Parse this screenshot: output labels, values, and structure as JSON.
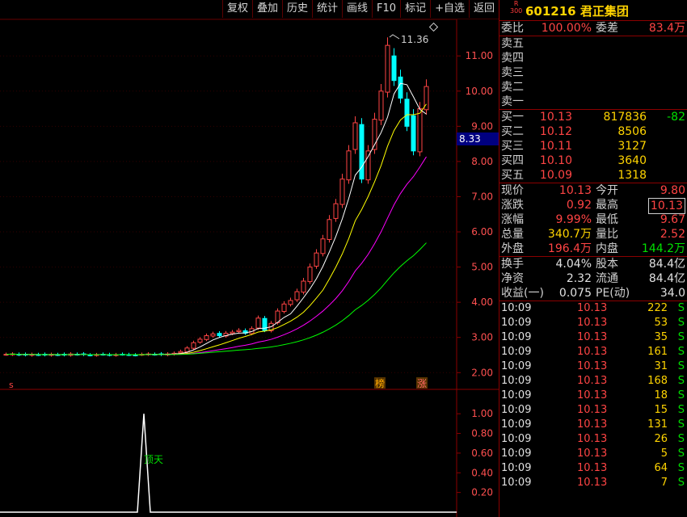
{
  "toolbar": [
    "复权",
    "叠加",
    "历史",
    "统计",
    "画线",
    "F10",
    "标记",
    "+自选",
    "返回"
  ],
  "chart_labels": {
    "high_label": "11.36",
    "current_price_tag": "8.33",
    "price_ticks": [
      "11.00",
      "10.00",
      "9.00",
      "8.00",
      "7.00",
      "6.00",
      "5.00",
      "4.00",
      "3.00",
      "2.00"
    ],
    "sub_ticks": [
      "1.00",
      "0.80",
      "0.60",
      "0.40",
      "0.20"
    ],
    "indicator_text": "顶天",
    "marker_s": "s",
    "marker_bang": "榜",
    "marker_zhang": "涨"
  },
  "colors": {
    "up": "#ff4444",
    "down": "#00ffff",
    "ma1": "#ffffff",
    "ma2": "#ffff00",
    "ma3": "#ff00ff",
    "ma4": "#00ff00"
  },
  "chart_data": {
    "type": "candlestick",
    "y_range": [
      1.8,
      11.9
    ],
    "close_series": [
      2.52,
      2.53,
      2.51,
      2.5,
      2.52,
      2.51,
      2.5,
      2.52,
      2.51,
      2.5,
      2.53,
      2.52,
      2.51,
      2.5,
      2.51,
      2.52,
      2.5,
      2.51,
      2.52,
      2.51,
      2.5,
      2.52,
      2.53,
      2.52,
      2.51,
      2.53,
      2.55,
      2.6,
      2.7,
      2.85,
      2.95,
      3.05,
      3.1,
      3.05,
      3.12,
      3.15,
      3.2,
      3.12,
      3.25,
      3.55,
      3.2,
      3.4,
      3.75,
      3.95,
      4.05,
      4.3,
      4.6,
      5.0,
      5.4,
      5.8,
      6.35,
      6.8,
      7.5,
      8.3,
      9.1,
      7.5,
      8.3,
      9.2,
      10.0,
      11.3,
      10.8,
      9.8,
      9.0,
      8.3,
      9.5,
      10.13
    ],
    "sub_peak": {
      "value": 1.0,
      "label": "顶天"
    },
    "sub_range": [
      0,
      1.1
    ]
  },
  "quote": {
    "r_label": "R",
    "r_sub": "300",
    "code_name": "601216 君正集团",
    "wei_bi_label": "委比",
    "wei_bi": "100.00%",
    "wei_cha_label": "委差",
    "wei_cha": "83.4万",
    "sell": [
      {
        "label": "卖五"
      },
      {
        "label": "卖四"
      },
      {
        "label": "卖三"
      },
      {
        "label": "卖二"
      },
      {
        "label": "卖一"
      }
    ],
    "buy": [
      {
        "label": "买一",
        "price": "10.13",
        "vol": "817836",
        "chg": "-82"
      },
      {
        "label": "买二",
        "price": "10.12",
        "vol": "8506",
        "chg": ""
      },
      {
        "label": "买三",
        "price": "10.11",
        "vol": "3127",
        "chg": ""
      },
      {
        "label": "买四",
        "price": "10.10",
        "vol": "3640",
        "chg": ""
      },
      {
        "label": "买五",
        "price": "10.09",
        "vol": "1318",
        "chg": ""
      }
    ],
    "stats": [
      {
        "l": "现价",
        "v": "10.13",
        "l2": "今开",
        "v2": "9.80"
      },
      {
        "l": "涨跌",
        "v": "0.92",
        "l2": "最高",
        "v2": "10.13"
      },
      {
        "l": "涨幅",
        "v": "9.99%",
        "l2": "最低",
        "v2": "9.67"
      },
      {
        "l": "总量",
        "v": "340.7万",
        "l2": "量比",
        "v2": "2.52"
      },
      {
        "l": "外盘",
        "v": "196.4万",
        "l2": "内盘",
        "v2": "144.2万"
      }
    ],
    "fin": [
      {
        "l": "换手",
        "v": "4.04%",
        "l2": "股本",
        "v2": "84.4亿"
      },
      {
        "l": "净资",
        "v": "2.32",
        "l2": "流通",
        "v2": "84.4亿"
      },
      {
        "l": "收益(一)",
        "v": "0.075",
        "l2": "PE(动)",
        "v2": "34.0"
      }
    ],
    "ticks": [
      {
        "t": "10:09",
        "p": "10.13",
        "v": "222",
        "s": "S"
      },
      {
        "t": "10:09",
        "p": "10.13",
        "v": "53",
        "s": "S"
      },
      {
        "t": "10:09",
        "p": "10.13",
        "v": "35",
        "s": "S"
      },
      {
        "t": "10:09",
        "p": "10.13",
        "v": "161",
        "s": "S"
      },
      {
        "t": "10:09",
        "p": "10.13",
        "v": "31",
        "s": "S"
      },
      {
        "t": "10:09",
        "p": "10.13",
        "v": "168",
        "s": "S"
      },
      {
        "t": "10:09",
        "p": "10.13",
        "v": "18",
        "s": "S"
      },
      {
        "t": "10:09",
        "p": "10.13",
        "v": "15",
        "s": "S"
      },
      {
        "t": "10:09",
        "p": "10.13",
        "v": "131",
        "s": "S"
      },
      {
        "t": "10:09",
        "p": "10.13",
        "v": "26",
        "s": "S"
      },
      {
        "t": "10:09",
        "p": "10.13",
        "v": "5",
        "s": "S"
      },
      {
        "t": "10:09",
        "p": "10.13",
        "v": "64",
        "s": "S"
      },
      {
        "t": "10:09",
        "p": "10.13",
        "v": "7",
        "s": "S"
      }
    ]
  }
}
